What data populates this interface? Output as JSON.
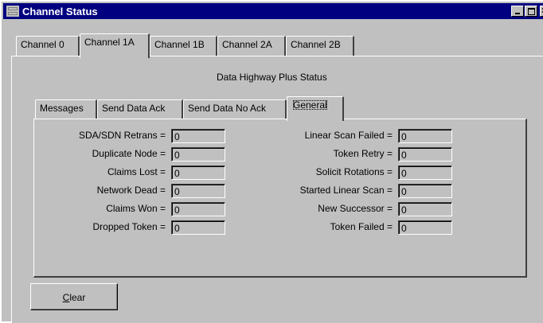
{
  "window": {
    "title": "Channel Status",
    "controls": [
      "minimize-icon",
      "maximize-icon",
      "close-icon"
    ]
  },
  "channel_tabs": [
    {
      "label": "Channel 0",
      "selected": false
    },
    {
      "label": "Channel 1A",
      "selected": true
    },
    {
      "label": "Channel 1B",
      "selected": false
    },
    {
      "label": "Channel 2A",
      "selected": false
    },
    {
      "label": "Channel 2B",
      "selected": false
    }
  ],
  "section_title": "Data Highway Plus Status",
  "sub_tabs": [
    {
      "label": "Messages",
      "selected": false
    },
    {
      "label": "Send Data Ack",
      "selected": false
    },
    {
      "label": "Send Data No Ack",
      "selected": false
    },
    {
      "label": "General",
      "selected": true
    }
  ],
  "stats_left": [
    {
      "label": "SDA/SDN Retrans =",
      "value": "0"
    },
    {
      "label": "Duplicate Node =",
      "value": "0"
    },
    {
      "label": "Claims Lost =",
      "value": "0"
    },
    {
      "label": "Network Dead =",
      "value": "0"
    },
    {
      "label": "Claims Won =",
      "value": "0"
    },
    {
      "label": "Dropped Token =",
      "value": "0"
    }
  ],
  "stats_right": [
    {
      "label": "Linear Scan Failed =",
      "value": "0"
    },
    {
      "label": "Token Retry =",
      "value": "0"
    },
    {
      "label": "Solicit Rotations =",
      "value": "0"
    },
    {
      "label": "Started Linear Scan =",
      "value": "0"
    },
    {
      "label": "New Successor =",
      "value": "0"
    },
    {
      "label": "Token Failed =",
      "value": "0"
    }
  ],
  "clear_button": {
    "label_prefix": "C",
    "label_rest": "lear"
  }
}
